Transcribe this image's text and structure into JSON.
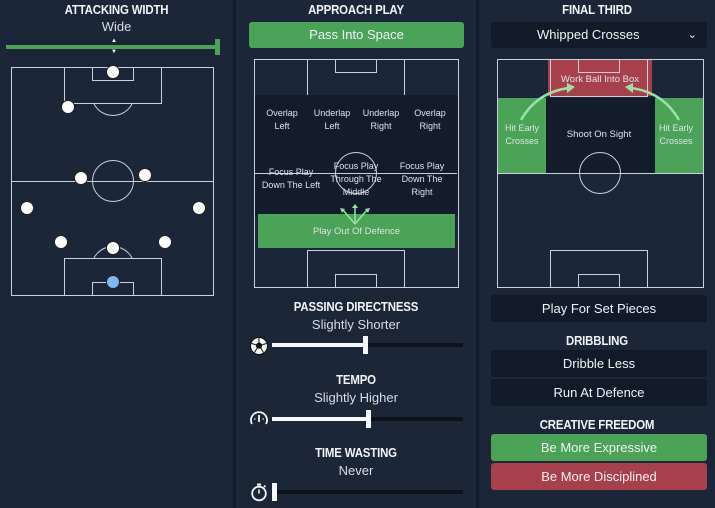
{
  "attacking_width": {
    "title": "ATTACKING WIDTH",
    "value": "Wide",
    "level": 1.0
  },
  "approach_play": {
    "title": "APPROACH PLAY",
    "selected_button": "Pass Into Space",
    "zones": {
      "overlap_left": "Overlap Left",
      "underlap_left": "Underlap Left",
      "underlap_right": "Underlap Right",
      "overlap_right": "Overlap Right",
      "focus_left": "Focus Play Down The Left",
      "focus_middle": "Focus Play Through The Middle",
      "focus_right": "Focus Play Down The Right",
      "play_out": "Play Out Of Defence"
    }
  },
  "passing_directness": {
    "title": "PASSING DIRECTNESS",
    "value": "Slightly Shorter",
    "level": 0.49,
    "icon": "football-icon"
  },
  "tempo": {
    "title": "TEMPO",
    "value": "Slightly Higher",
    "level": 0.51,
    "icon": "speedometer-icon"
  },
  "time_wasting": {
    "title": "TIME WASTING",
    "value": "Never",
    "level": 0.0,
    "icon": "stopwatch-icon"
  },
  "final_third": {
    "title": "FINAL THIRD",
    "dropdown_value": "Whipped Crosses",
    "zones": {
      "work_ball": "Work Ball Into Box",
      "hit_early_left": "Hit Early Crosses",
      "shoot_on_sight": "Shoot On Sight",
      "hit_early_right": "Hit Early Crosses"
    },
    "set_pieces": "Play For Set Pieces"
  },
  "dribbling": {
    "title": "DRIBBLING",
    "options": [
      "Dribble Less",
      "Run At Defence"
    ]
  },
  "creative_freedom": {
    "title": "CREATIVE FREEDOM",
    "expressive": "Be More Expressive",
    "disciplined": "Be More Disciplined"
  },
  "colors": {
    "background": "#1b2638",
    "green": "#4aa356",
    "red": "#a8404b",
    "keeper": "#7fb9f0"
  }
}
